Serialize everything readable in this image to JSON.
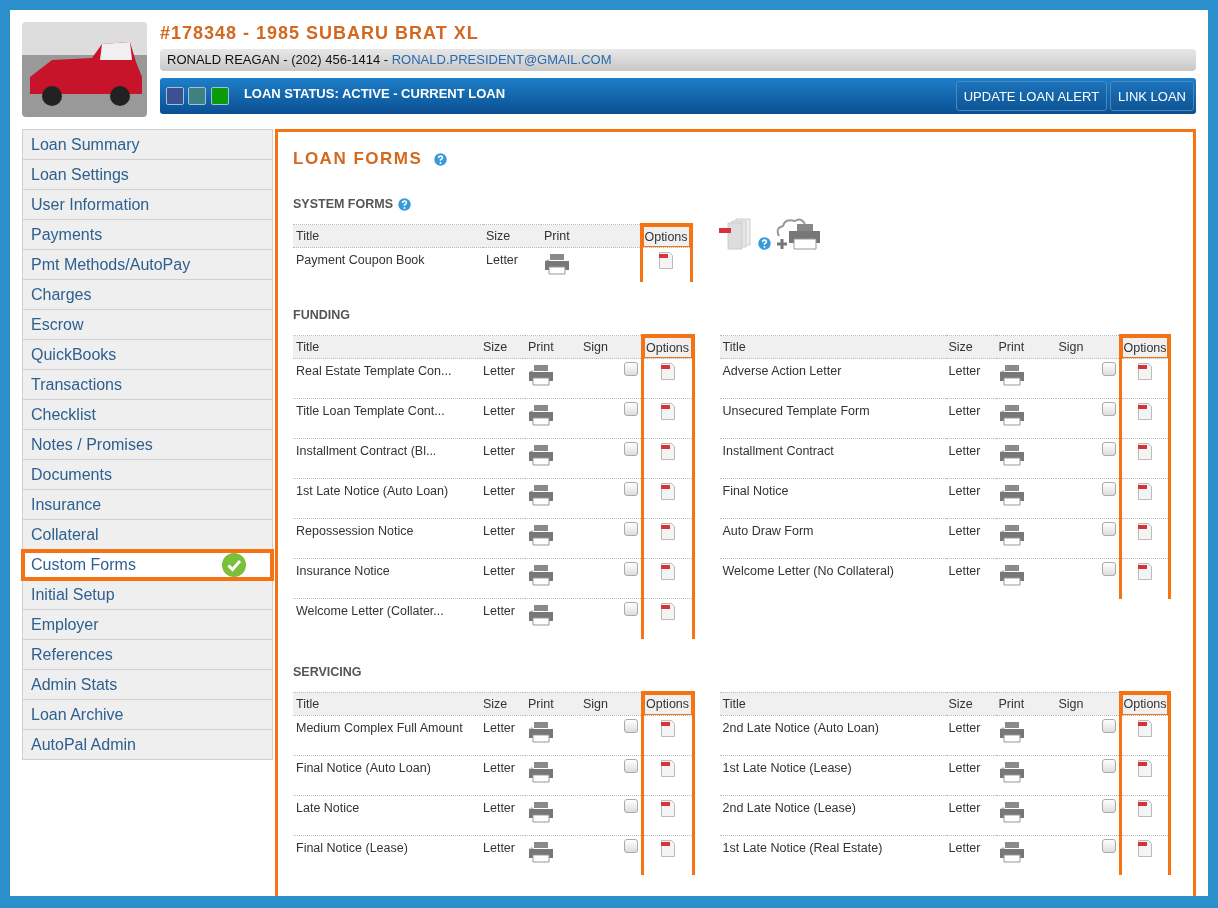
{
  "header": {
    "title": "#178348 - 1985 SUBARU BRAT XL",
    "contact": "RONALD REAGAN - (202) 456-1414 - ",
    "email": "RONALD.PRESIDENT@GMAIL.COM",
    "swatches": [
      {
        "color": "#3c4f8e"
      },
      {
        "color": "#3f8080"
      },
      {
        "color": "#0a9a0a"
      }
    ],
    "status": "LOAN STATUS: ACTIVE - CURRENT LOAN",
    "buttons": [
      "UPDATE LOAN ALERT",
      "LINK LOAN"
    ]
  },
  "sidebar": {
    "items": [
      {
        "label": "Loan Summary",
        "selected": false
      },
      {
        "label": "Loan Settings",
        "selected": false
      },
      {
        "label": "User Information",
        "selected": false
      },
      {
        "label": "Payments",
        "selected": false
      },
      {
        "label": "Pmt Methods/AutoPay",
        "selected": false
      },
      {
        "label": "Charges",
        "selected": false
      },
      {
        "label": "Escrow",
        "selected": false
      },
      {
        "label": "QuickBooks",
        "selected": false
      },
      {
        "label": "Transactions",
        "selected": false
      },
      {
        "label": "Checklist",
        "selected": false
      },
      {
        "label": "Notes / Promises",
        "selected": false
      },
      {
        "label": "Documents",
        "selected": false
      },
      {
        "label": "Insurance",
        "selected": false
      },
      {
        "label": "Collateral",
        "selected": false
      },
      {
        "label": "Custom Forms",
        "selected": true
      },
      {
        "label": "Initial Setup",
        "selected": false
      },
      {
        "label": "Employer",
        "selected": false
      },
      {
        "label": "References",
        "selected": false
      },
      {
        "label": "Admin Stats",
        "selected": false
      },
      {
        "label": "Loan Archive",
        "selected": false
      },
      {
        "label": "AutoPal Admin",
        "selected": false
      }
    ]
  },
  "loan_forms": {
    "title": "LOAN FORMS",
    "sections": [
      {
        "title": "SYSTEM FORMS",
        "kind": "system",
        "tables": [
          {
            "columns": [
              {
                "label": "Title",
                "highlighted": false
              },
              {
                "label": "Size",
                "highlighted": false
              },
              {
                "label": "Print",
                "highlighted": false
              },
              {
                "label": "Options",
                "highlighted": true
              }
            ],
            "rows": [
              {
                "title": "Payment Coupon Book",
                "size": "Letter"
              }
            ]
          }
        ]
      },
      {
        "title": "FUNDING",
        "kind": "signed",
        "tables": [
          {
            "columns": [
              {
                "label": "Title",
                "highlighted": false
              },
              {
                "label": "Size",
                "highlighted": false
              },
              {
                "label": "Print",
                "highlighted": false
              },
              {
                "label": "Sign",
                "highlighted": false
              },
              {
                "label": "Options",
                "highlighted": true
              }
            ],
            "rows": [
              {
                "title": "Real Estate Template Con...",
                "size": "Letter",
                "sign": false
              },
              {
                "title": "Title Loan Template Cont...",
                "size": "Letter",
                "sign": false
              },
              {
                "title": "Installment Contract (Bl...",
                "size": "Letter",
                "sign": false
              },
              {
                "title": "1st Late Notice (Auto Loan)",
                "size": "Letter",
                "sign": false
              },
              {
                "title": "Repossession Notice",
                "size": "Letter",
                "sign": false
              },
              {
                "title": "Insurance Notice",
                "size": "Letter",
                "sign": false
              },
              {
                "title": "Welcome Letter (Collater...",
                "size": "Letter",
                "sign": false
              }
            ]
          },
          {
            "columns": [
              {
                "label": "Title",
                "highlighted": false
              },
              {
                "label": "Size",
                "highlighted": false
              },
              {
                "label": "Print",
                "highlighted": false
              },
              {
                "label": "Sign",
                "highlighted": false
              },
              {
                "label": "Options",
                "highlighted": true
              }
            ],
            "rows": [
              {
                "title": "Adverse Action Letter",
                "size": "Letter",
                "sign": false
              },
              {
                "title": "Unsecured Template Form",
                "size": "Letter",
                "sign": false
              },
              {
                "title": "Installment Contract",
                "size": "Letter",
                "sign": false
              },
              {
                "title": "Final Notice",
                "size": "Letter",
                "sign": false
              },
              {
                "title": "Auto Draw Form",
                "size": "Letter",
                "sign": false
              },
              {
                "title": "Welcome Letter (No Collateral)",
                "size": "Letter",
                "sign": false
              }
            ]
          }
        ]
      },
      {
        "title": "SERVICING",
        "kind": "signed",
        "tables": [
          {
            "columns": [
              {
                "label": "Title",
                "highlighted": false
              },
              {
                "label": "Size",
                "highlighted": false
              },
              {
                "label": "Print",
                "highlighted": false
              },
              {
                "label": "Sign",
                "highlighted": false
              },
              {
                "label": "Options",
                "highlighted": true
              }
            ],
            "rows": [
              {
                "title": "Medium Complex Full Amount",
                "size": "Letter",
                "sign": false
              },
              {
                "title": "Final Notice (Auto Loan)",
                "size": "Letter",
                "sign": false
              },
              {
                "title": "Late Notice",
                "size": "Letter",
                "sign": false
              },
              {
                "title": "Final Notice (Lease)",
                "size": "Letter",
                "sign": false
              }
            ]
          },
          {
            "columns": [
              {
                "label": "Title",
                "highlighted": false
              },
              {
                "label": "Size",
                "highlighted": false
              },
              {
                "label": "Print",
                "highlighted": false
              },
              {
                "label": "Sign",
                "highlighted": false
              },
              {
                "label": "Options",
                "highlighted": true
              }
            ],
            "rows": [
              {
                "title": "2nd Late Notice (Auto Loan)",
                "size": "Letter",
                "sign": false
              },
              {
                "title": "1st Late Notice (Lease)",
                "size": "Letter",
                "sign": false
              },
              {
                "title": "2nd Late Notice (Lease)",
                "size": "Letter",
                "sign": false
              },
              {
                "title": "1st Late Notice (Real Estate)",
                "size": "Letter",
                "sign": false
              }
            ]
          }
        ]
      }
    ]
  }
}
